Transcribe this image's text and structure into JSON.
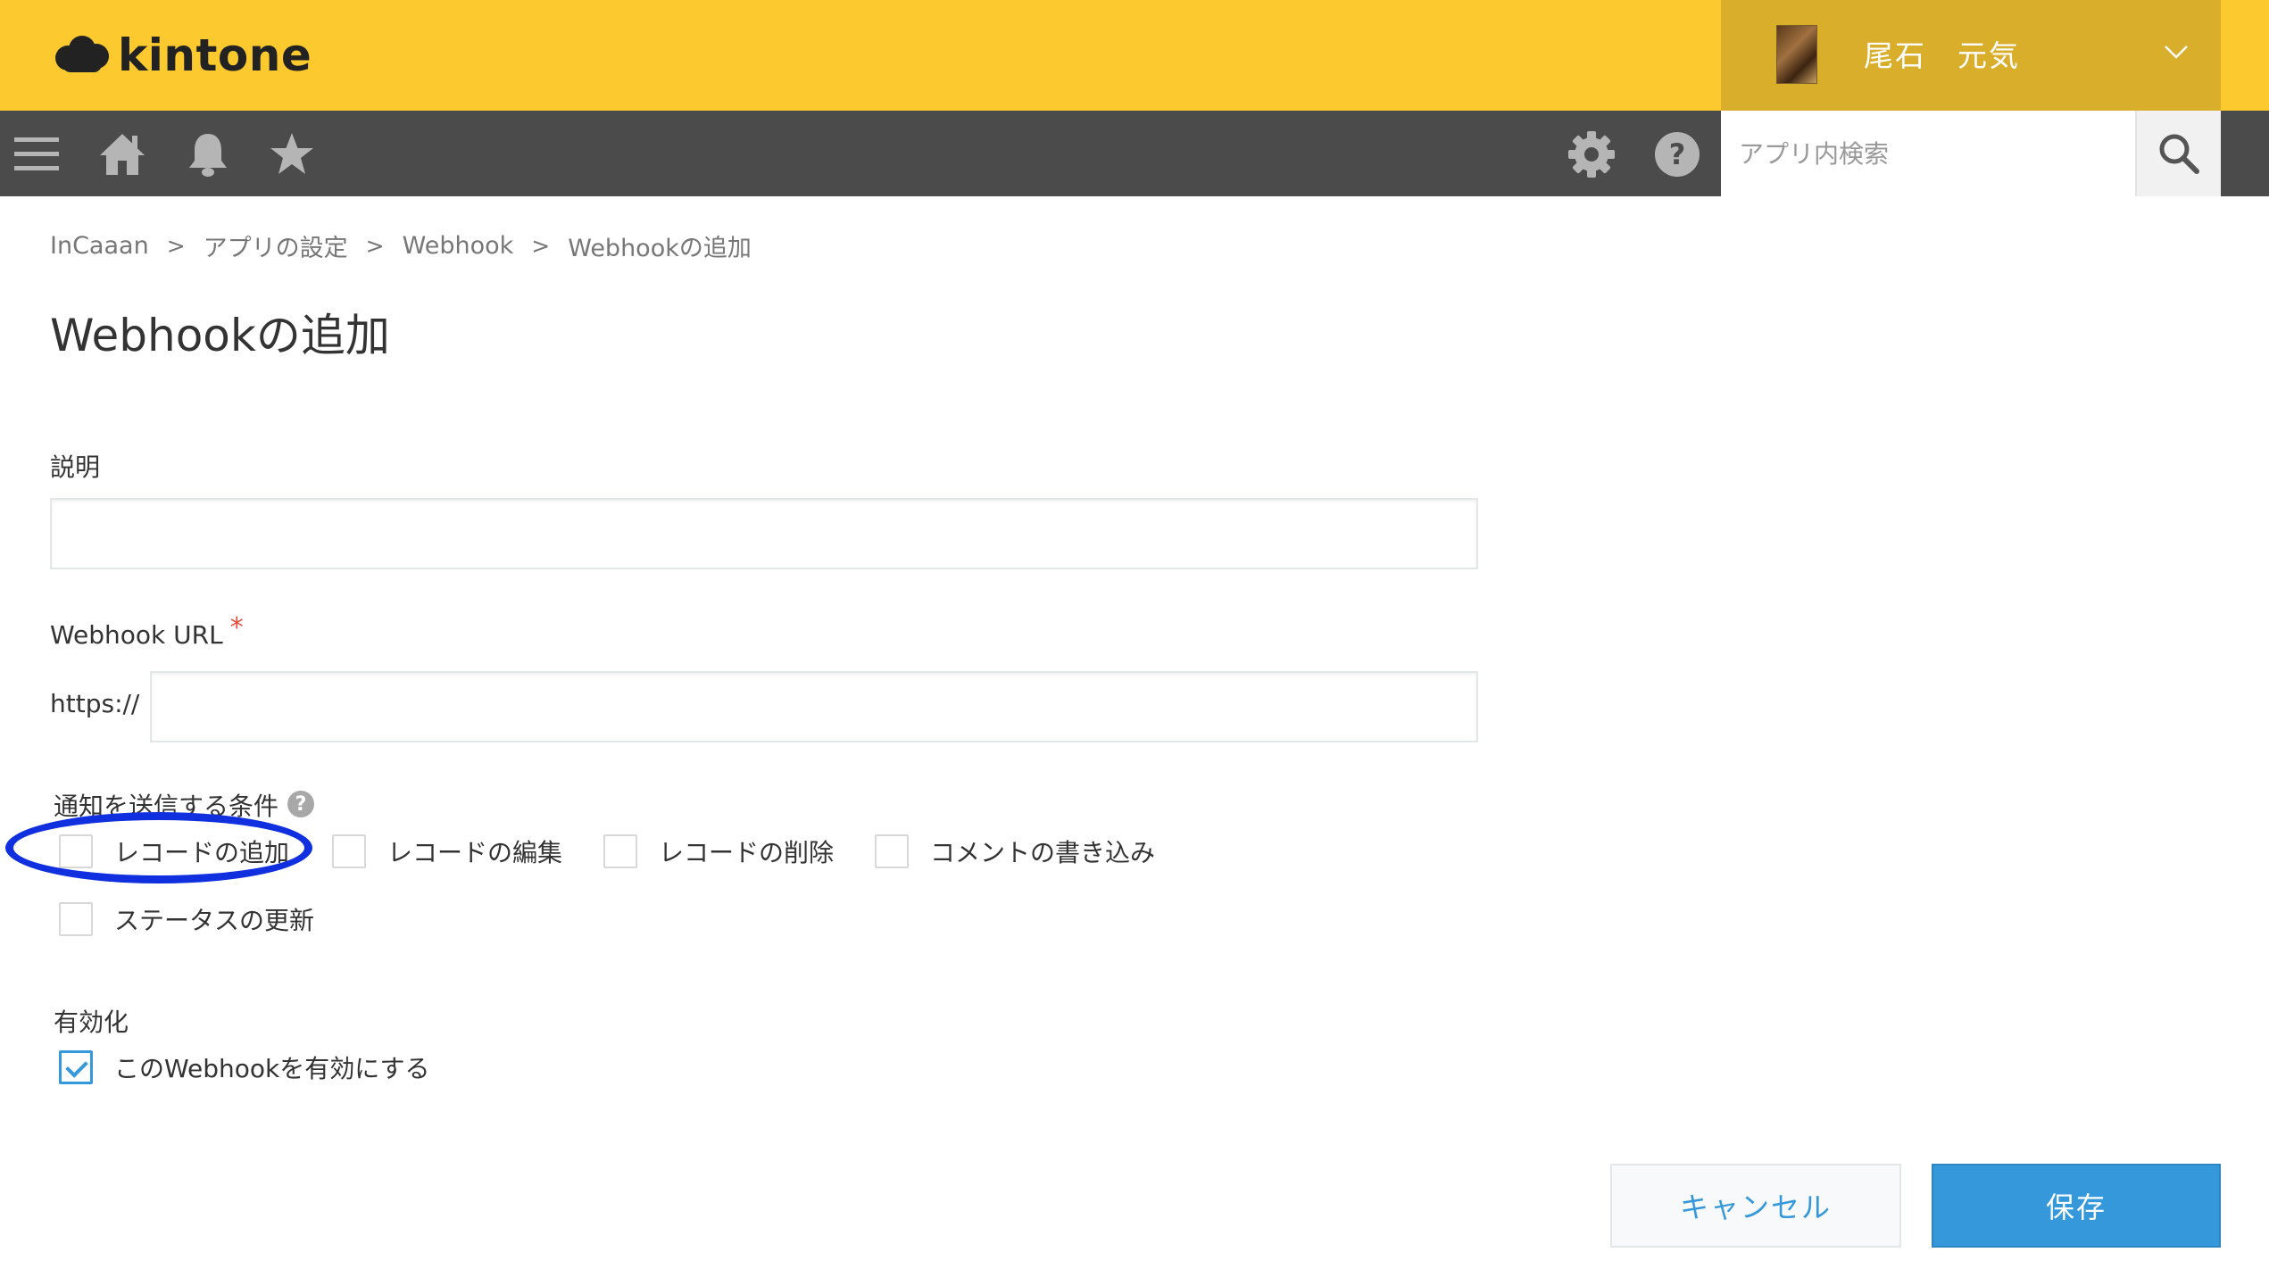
{
  "header": {
    "logo_text": "kintone",
    "user_name": "尾石　元気",
    "colors": {
      "header_bg": "#fcc92e",
      "user_bg": "#d9ae2a",
      "nav_bg": "#4b4b4b"
    }
  },
  "navbar": {
    "icons": [
      "menu-icon",
      "home-icon",
      "bell-icon",
      "star-icon",
      "gear-icon",
      "help-icon",
      "search-icon"
    ],
    "search_placeholder": "アプリ内検索"
  },
  "breadcrumb": {
    "items": [
      "InCaaan",
      "アプリの設定",
      "Webhook",
      "Webhookの追加"
    ],
    "separator": ">"
  },
  "page_title": "Webhookの追加",
  "form": {
    "description": {
      "label": "説明",
      "value": ""
    },
    "webhook_url": {
      "label": "Webhook URL",
      "required_mark": "*",
      "prefix": "https://",
      "value": ""
    },
    "conditions": {
      "label": "通知を送信する条件",
      "help": "?",
      "options": [
        {
          "label": "レコードの追加",
          "checked": false
        },
        {
          "label": "レコードの編集",
          "checked": false
        },
        {
          "label": "レコードの削除",
          "checked": false
        },
        {
          "label": "コメントの書き込み",
          "checked": false
        },
        {
          "label": "ステータスの更新",
          "checked": false
        }
      ]
    },
    "enable": {
      "label": "有効化",
      "option_label": "このWebhookを有効にする",
      "checked": true
    }
  },
  "buttons": {
    "cancel": "キャンセル",
    "save": "保存"
  },
  "accent_colors": {
    "primary": "#3498db",
    "annotation": "#1030e0",
    "required": "#e74c3c"
  }
}
